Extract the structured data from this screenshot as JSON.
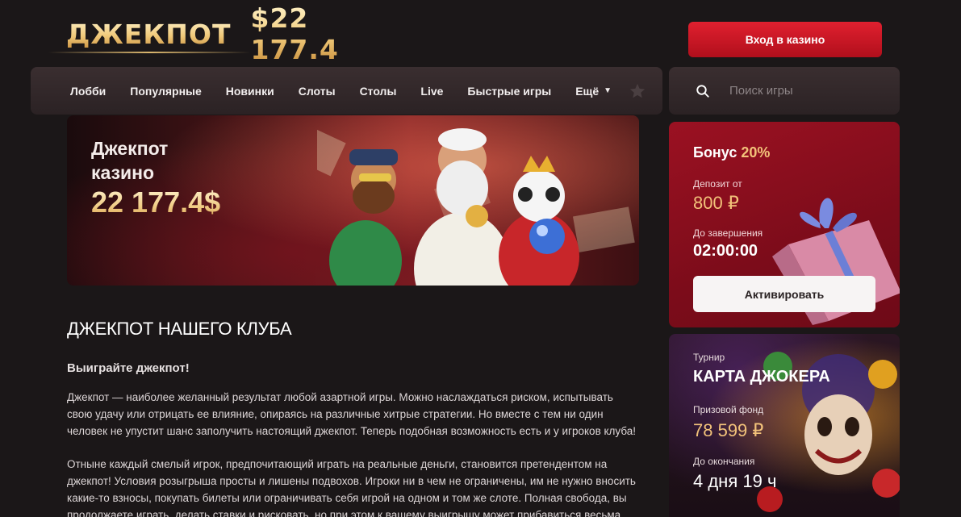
{
  "header": {
    "jackpot_title": "ДЖЕКПОТ",
    "jackpot_amount": "$22 177.4",
    "login_label": "Вход в казино"
  },
  "nav": {
    "items": [
      "Лобби",
      "Популярные",
      "Новинки",
      "Слоты",
      "Столы",
      "Live",
      "Быстрые игры",
      "Ещё"
    ],
    "favorites_icon": "star-icon"
  },
  "search": {
    "placeholder": "Поиск игры",
    "icon": "search-icon"
  },
  "banner": {
    "line1": "Джекпот",
    "line2": "казино",
    "amount": "22 177.4$"
  },
  "article": {
    "title": "ДЖЕКПОТ НАШЕГО КЛУБА",
    "subtitle": "Выиграйте джекпот!",
    "paragraph1": "Джекпот — наиболее желанный результат любой азартной игры. Можно наслаждаться риском, испытывать свою удачу или отрицать ее влияние, опираясь на различные хитрые стратегии. Но вместе с тем ни один человек не упустит шанс заполучить настоящий джекпот. Теперь подобная возможность есть и у игроков клуба!",
    "paragraph2": "Отныне каждый смелый игрок, предпочитающий играть на реальные деньги, становится претендентом на джекпот! Условия розыгрыша просты и лишены подвохов. Игроки ни в чем не ограничены, им не нужно вносить какие-то взносы, покупать билеты или ограничивать себя игрой на одном и том же слоте. Полная свобода, вы продолжаете играть, делать ставки и рисковать, но при этом к вашему выигрышу может прибавиться весьма"
  },
  "bonus": {
    "title": "Бонус",
    "percent": "20%",
    "deposit_label": "Депозит от",
    "deposit_value": "800 ₽",
    "end_label": "До завершения",
    "timer": "02:00:00",
    "activate_label": "Активировать"
  },
  "tournament": {
    "label": "Турнир",
    "title": "КАРТА ДЖОКЕРА",
    "prize_label": "Призовой фонд",
    "prize_value": "78 599 ₽",
    "until_label": "До окончания",
    "time_left": "4 дня  19 ч"
  },
  "colors": {
    "accent_red": "#c81424",
    "gold": "#f2c27a",
    "background": "#1b1718",
    "nav_bg": "#33292b",
    "bonus_bg": "#8a0f1e"
  }
}
